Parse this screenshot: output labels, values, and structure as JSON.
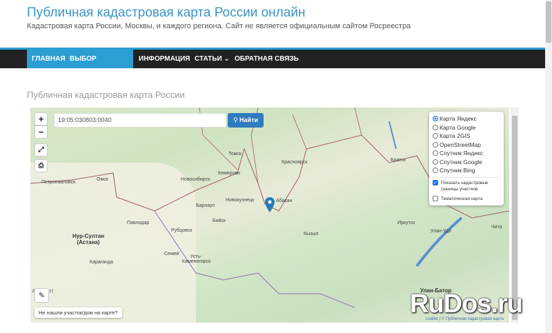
{
  "header": {
    "title": "Публичная кадастровая карта России онлайн",
    "description": "Кадастровая карта России, Москвы, и каждого региона. Сайт не является официальным сайтом Росреестра"
  },
  "nav": {
    "items": [
      {
        "label": "Главная",
        "active": true
      },
      {
        "label": "Выбор региона ⌄",
        "active": true
      },
      {
        "label": "Информация"
      },
      {
        "label": "Статьи ⌄"
      },
      {
        "label": "Обратная связь"
      }
    ]
  },
  "page": {
    "heading": "Публичная кадастровая карта России"
  },
  "map": {
    "zoom_in": "+",
    "zoom_out": "−",
    "search_value": "19:05:030803:0040",
    "search_button": "Найти",
    "layers": [
      "Карта Яндекс",
      "Карта Google",
      "Карта 2GIS",
      "OpenStreetMap",
      "Спутник Яндекс",
      "Спутник Google",
      "Спутник Bing"
    ],
    "selected_layer": "Карта Яндекс",
    "overlays": [
      {
        "label": "Показать кадастровые границы участков",
        "checked": true
      },
      {
        "label": "Тематическая карта",
        "checked": false
      }
    ],
    "not_found": "Не нашли участок/дом на карте?",
    "attribution": "Leaflet | © Публичная кадастровая карта",
    "cities": [
      "Томск",
      "Кемерово",
      "Красноярск",
      "Петропавловск",
      "Омск",
      "Новосибирск",
      "Новокузнецк",
      "Абакан",
      "Барнаул",
      "Бийск",
      "Павлодар",
      "Нур-Султан (Астана)",
      "Рубцовск",
      "Семей",
      "Усть-Каменогорск",
      "Караганда",
      "Кызыл",
      "Иркутск",
      "Улан-Удэ",
      "Чита",
      "Улан-Батор",
      "Братск",
      "АЗСТАН"
    ],
    "marker_color": "#2a7ab8"
  },
  "watermark": "RuDos.ru",
  "colors": {
    "accent": "#2b9ed4",
    "nav_bg": "#222222",
    "button": "#2f7bbf"
  }
}
